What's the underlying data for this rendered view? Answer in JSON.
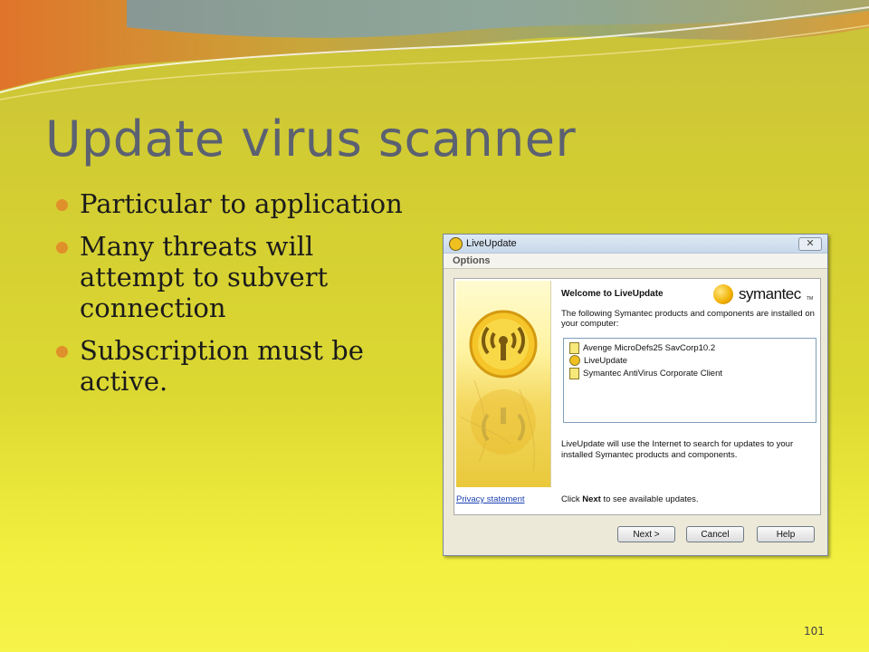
{
  "slide": {
    "title": "Update virus scanner",
    "bullets": [
      "Particular to application",
      "Many threats will attempt to subvert connection",
      "Subscription must be active."
    ],
    "page_number": "101"
  },
  "window": {
    "title": "LiveUpdate",
    "menu": "Options",
    "welcome": "Welcome to LiveUpdate",
    "brand": "symantec",
    "brand_tm": "TM",
    "intro": "The following Symantec products and components are installed on your computer:",
    "products": [
      "Avenge MicroDefs25 SavCorp10.2",
      "LiveUpdate",
      "Symantec AntiVirus Corporate Client"
    ],
    "info": "LiveUpdate will use the Internet to search for updates to your installed Symantec products and components.",
    "privacy_link": "Privacy statement",
    "click_prefix": "Click ",
    "click_bold": "Next",
    "click_suffix": " to see available updates.",
    "buttons": {
      "next": "Next >",
      "cancel": "Cancel",
      "help": "Help"
    }
  },
  "colors": {
    "title": "#5b6171",
    "bullet_dot": "#e0902a",
    "link": "#1a3fb0"
  },
  "icons": [
    "close-icon",
    "liveupdate-icon",
    "symantec-logo-icon",
    "signal-icon",
    "document-icon"
  ]
}
